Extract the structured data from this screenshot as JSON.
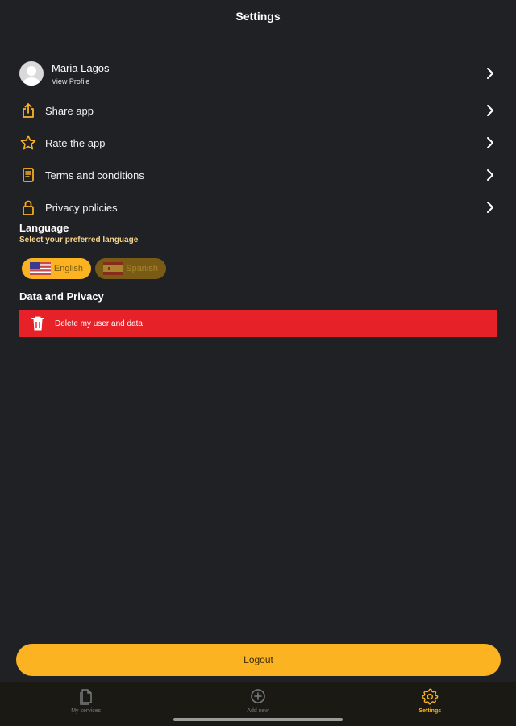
{
  "header": {
    "title": "Settings"
  },
  "profile": {
    "name": "Maria Lagos",
    "subtitle": "View Profile"
  },
  "menu": {
    "items": [
      {
        "label": "Share app",
        "icon": "share-icon"
      },
      {
        "label": "Rate the app",
        "icon": "star-icon"
      },
      {
        "label": "Terms and conditions",
        "icon": "document-icon"
      },
      {
        "label": "Privacy policies",
        "icon": "lock-icon"
      }
    ]
  },
  "language": {
    "title": "Language",
    "subtitle": "Select your preferred language",
    "options": [
      {
        "label": "English",
        "flag": "us-flag-icon",
        "selected": true
      },
      {
        "label": "Spanish",
        "flag": "spain-flag-icon",
        "selected": false
      }
    ]
  },
  "data_privacy": {
    "title": "Data and Privacy",
    "delete_label": "Delete my user and data"
  },
  "logout": {
    "label": "Logout"
  },
  "tabs": [
    {
      "label": "My services",
      "icon": "documents-icon",
      "active": false
    },
    {
      "label": "Add new",
      "icon": "plus-circle-icon",
      "active": false
    },
    {
      "label": "Settings",
      "icon": "gear-icon",
      "active": true
    }
  ],
  "colors": {
    "background": "#202124",
    "accent": "#fbb321",
    "danger": "#e62127",
    "tabbar": "#1b1913"
  }
}
